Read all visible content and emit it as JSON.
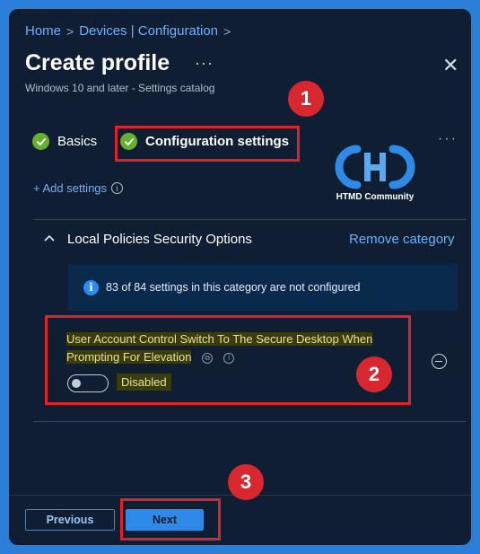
{
  "breadcrumb": {
    "items": [
      "Home",
      "Devices | Configuration"
    ],
    "separator": ">"
  },
  "header": {
    "title": "Create profile",
    "more": "···",
    "subtitle": "Windows 10 and later - Settings catalog",
    "close": "✕"
  },
  "steps": [
    {
      "label": "Basics",
      "status": "complete"
    },
    {
      "label": "Configuration settings",
      "status": "complete"
    }
  ],
  "tabs_more": "···",
  "add_settings": "+ Add settings",
  "logo": {
    "text": "HTMD Community"
  },
  "category": {
    "title": "Local Policies Security Options",
    "remove": "Remove category",
    "info": "83 of 84 settings in this category are not configured"
  },
  "setting": {
    "name_line1": "User Account Control Switch To The Secure Desktop When",
    "name_line2": "Prompting For Elevation",
    "value": "Disabled",
    "enabled": false
  },
  "footer": {
    "previous": "Previous",
    "next": "Next"
  },
  "annotations": [
    "1",
    "2",
    "3"
  ],
  "colors": {
    "accent": "#6fb1ff",
    "highlight_red": "#e0222b",
    "check_green": "#65b12f",
    "primary_button": "#2e8ae6"
  }
}
